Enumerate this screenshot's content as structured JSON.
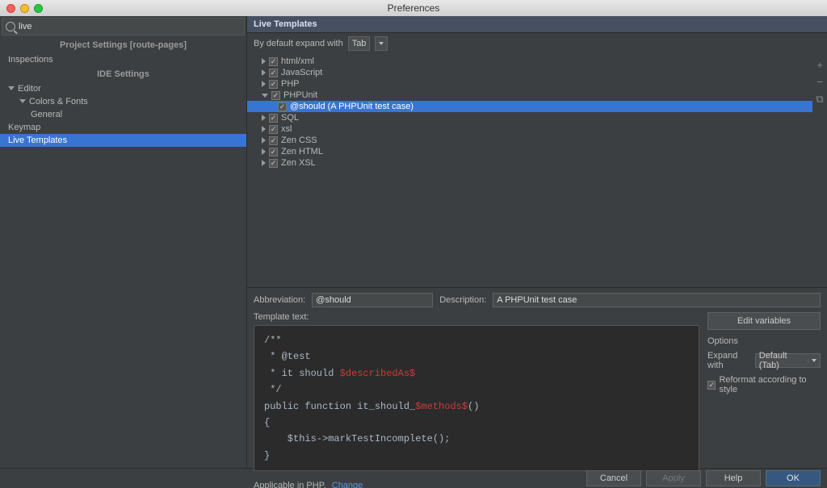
{
  "window": {
    "title": "Preferences"
  },
  "search": {
    "value": "live"
  },
  "sidebar": {
    "section1": "Project Settings [route-pages]",
    "section2": "IDE Settings",
    "items": {
      "inspections": "Inspections",
      "editor": "Editor",
      "colors": "Colors & Fonts",
      "general": "General",
      "keymap": "Keymap",
      "livetemplates": "Live Templates"
    }
  },
  "main": {
    "title": "Live Templates",
    "expand_label": "By default expand with",
    "expand_value": "Tab",
    "groups": [
      {
        "name": "html/xml",
        "expanded": false
      },
      {
        "name": "JavaScript",
        "expanded": false
      },
      {
        "name": "PHP",
        "expanded": false
      },
      {
        "name": "PHPUnit",
        "expanded": true,
        "child": "@should (A PHPUnit test case)"
      },
      {
        "name": "SQL",
        "expanded": false
      },
      {
        "name": "xsl",
        "expanded": false
      },
      {
        "name": "Zen CSS",
        "expanded": false
      },
      {
        "name": "Zen HTML",
        "expanded": false
      },
      {
        "name": "Zen XSL",
        "expanded": false
      }
    ],
    "side": {
      "add": "+",
      "remove": "−",
      "copy": "⧉"
    },
    "abbrev_label": "Abbreviation:",
    "abbrev_value": "@should",
    "desc_label": "Description:",
    "desc_value": "A PHPUnit test case",
    "template_label": "Template text:",
    "code": {
      "l1": "/**",
      "l2": " * @test",
      "l3a": " * it should ",
      "l3b": "$describedAs$",
      "l4": " */",
      "l5a": "public function it_should_",
      "l5b": "$methods$",
      "l5c": "()",
      "l6": "{",
      "l7": "    $this->markTestIncomplete();",
      "l8": "}"
    },
    "edit_vars": "Edit variables",
    "options_label": "Options",
    "expand2_label": "Expand with",
    "expand2_value": "Default (Tab)",
    "reformat": "Reformat according to style",
    "applicable": "Applicable in PHP.",
    "change": "Change"
  },
  "footer": {
    "cancel": "Cancel",
    "apply": "Apply",
    "help": "Help",
    "ok": "OK"
  }
}
